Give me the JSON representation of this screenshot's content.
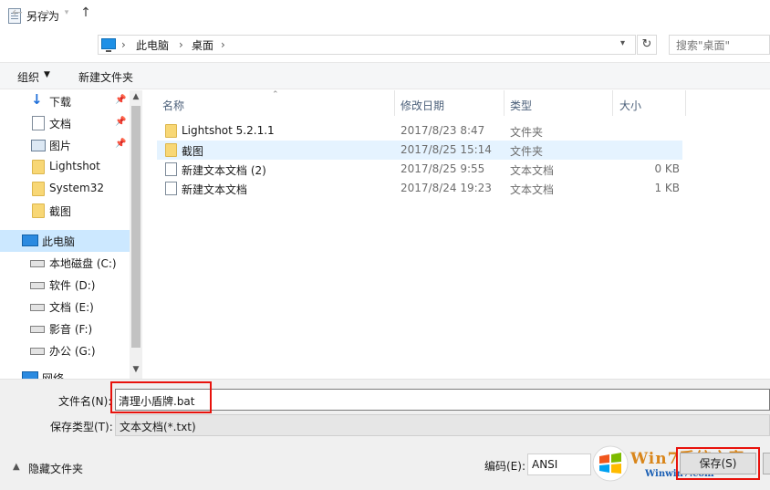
{
  "window": {
    "title": "另存为"
  },
  "address": {
    "breadcrumb": [
      "此电脑",
      "桌面"
    ],
    "search_placeholder": "搜索\"桌面\""
  },
  "toolbar": {
    "organize": "组织",
    "new_folder": "新建文件夹"
  },
  "nav": {
    "items": [
      {
        "label": "下载",
        "icon": "download-icon",
        "pinned": true
      },
      {
        "label": "文档",
        "icon": "document-icon",
        "pinned": true
      },
      {
        "label": "图片",
        "icon": "picture-icon",
        "pinned": true
      },
      {
        "label": "Lightshot",
        "icon": "folder-icon",
        "pinned": false
      },
      {
        "label": "System32",
        "icon": "folder-icon",
        "pinned": false
      },
      {
        "label": "截图",
        "icon": "folder-icon",
        "pinned": false
      },
      {
        "label": "此电脑",
        "icon": "computer-icon",
        "selected": true
      },
      {
        "label": "本地磁盘 (C:)",
        "icon": "drive-icon"
      },
      {
        "label": "软件 (D:)",
        "icon": "drive-icon"
      },
      {
        "label": "文档 (E:)",
        "icon": "drive-icon"
      },
      {
        "label": "影音 (F:)",
        "icon": "drive-icon"
      },
      {
        "label": "办公 (G:)",
        "icon": "drive-icon"
      },
      {
        "label": "网络",
        "icon": "network-icon"
      }
    ]
  },
  "filelist": {
    "columns": {
      "name": "名称",
      "date": "修改日期",
      "type": "类型",
      "size": "大小"
    },
    "rows": [
      {
        "name": "Lightshot 5.2.1.1",
        "date": "2017/8/23 8:47",
        "type": "文件夹",
        "size": "",
        "icon": "folder-icon"
      },
      {
        "name": "截图",
        "date": "2017/8/25 15:14",
        "type": "文件夹",
        "size": "",
        "icon": "folder-icon"
      },
      {
        "name": "新建文本文档 (2)",
        "date": "2017/8/25 9:55",
        "type": "文本文档",
        "size": "0 KB",
        "icon": "text-file-icon"
      },
      {
        "name": "新建文本文档",
        "date": "2017/8/24 19:23",
        "type": "文本文档",
        "size": "1 KB",
        "icon": "text-file-icon"
      }
    ]
  },
  "form": {
    "filename_label": "文件名(N):",
    "filename_value": "清理小盾牌.bat",
    "filetype_label": "保存类型(T):",
    "filetype_value": "文本文档(*.txt)",
    "hide_folders": "隐藏文件夹",
    "encoding_label": "编码(E):",
    "encoding_value": "ANSI",
    "save": "保存(S)"
  },
  "watermark": {
    "title": "Win7系统之家",
    "url": "Winwin7.com"
  },
  "colors": {
    "highlight_red": "#e8120c",
    "selection_blue": "#cce8ff",
    "row_hover": "#e5f3ff"
  }
}
